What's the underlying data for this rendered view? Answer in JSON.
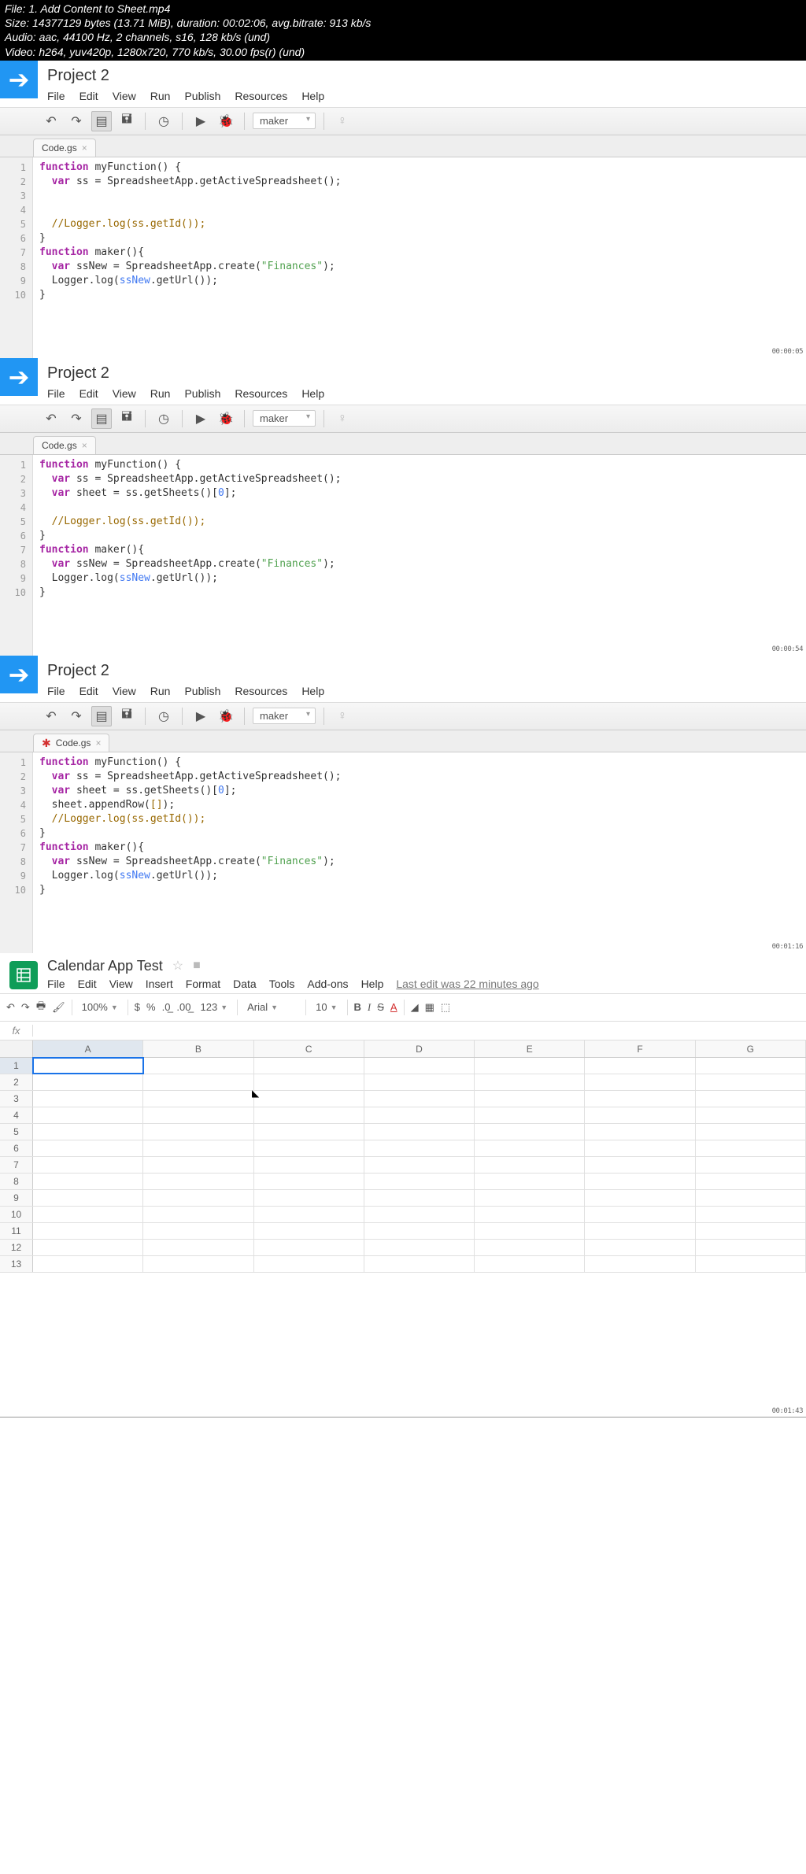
{
  "info": {
    "l1": "File: 1. Add Content to Sheet.mp4",
    "l2": "Size: 14377129 bytes (13.71 MiB), duration: 00:02:06, avg.bitrate: 913 kb/s",
    "l3": "Audio: aac, 44100 Hz, 2 channels, s16, 128 kb/s (und)",
    "l4": "Video: h264, yuv420p, 1280x720, 770 kb/s, 30.00 fps(r) (und)"
  },
  "menus": {
    "file": "File",
    "edit": "Edit",
    "view": "View",
    "run": "Run",
    "publish": "Publish",
    "resources": "Resources",
    "help": "Help"
  },
  "toolbar": {
    "func": "maker"
  },
  "pane1": {
    "title": "Project 2",
    "tab": "Code.gs",
    "dirty": false,
    "lines": [
      "1",
      "2",
      "3",
      "4",
      "5",
      "6",
      "7",
      "8",
      "9",
      "10"
    ],
    "code": [
      {
        "t": "function",
        "c": "kw"
      },
      {
        "t": " myFunction() {\n  ",
        "c": ""
      },
      {
        "t": "var",
        "c": "kw"
      },
      {
        "t": " ss = SpreadsheetApp.getActiveSpreadsheet();\n  \n  \n  ",
        "c": ""
      },
      {
        "t": "//Logger.log(ss.getId());",
        "c": "com"
      },
      {
        "t": "\n}\n",
        "c": ""
      },
      {
        "t": "function",
        "c": "kw"
      },
      {
        "t": " maker(){\n  ",
        "c": ""
      },
      {
        "t": "var",
        "c": "kw"
      },
      {
        "t": " ssNew = SpreadsheetApp.create(",
        "c": ""
      },
      {
        "t": "\"Finances\"",
        "c": "str"
      },
      {
        "t": ");\n  Logger.log(",
        "c": ""
      },
      {
        "t": "ssNew",
        "c": "var2"
      },
      {
        "t": ".getUrl());\n}\n",
        "c": ""
      }
    ],
    "ts": "00:00:05"
  },
  "pane2": {
    "title": "Project 2",
    "tab": "Code.gs",
    "dirty": false,
    "lines": [
      "1",
      "2",
      "3",
      "4",
      "5",
      "6",
      "7",
      "8",
      "9",
      "10"
    ],
    "code": [
      {
        "t": "function",
        "c": "kw"
      },
      {
        "t": " myFunction() {\n  ",
        "c": ""
      },
      {
        "t": "var",
        "c": "kw"
      },
      {
        "t": " ss = SpreadsheetApp.getActiveSpreadsheet();\n  ",
        "c": ""
      },
      {
        "t": "var",
        "c": "kw"
      },
      {
        "t": " sheet = ss.getSheets()[",
        "c": ""
      },
      {
        "t": "0",
        "c": "num"
      },
      {
        "t": "];\n  \n  ",
        "c": ""
      },
      {
        "t": "//Logger.log(ss.getId());",
        "c": "com"
      },
      {
        "t": "\n}\n",
        "c": ""
      },
      {
        "t": "function",
        "c": "kw"
      },
      {
        "t": " maker(){\n  ",
        "c": ""
      },
      {
        "t": "var",
        "c": "kw"
      },
      {
        "t": " ssNew = SpreadsheetApp.create(",
        "c": ""
      },
      {
        "t": "\"Finances\"",
        "c": "str"
      },
      {
        "t": ");\n  Logger.log(",
        "c": ""
      },
      {
        "t": "ssNew",
        "c": "var2"
      },
      {
        "t": ".getUrl());\n}\n",
        "c": ""
      }
    ],
    "ts": "00:00:54"
  },
  "pane3": {
    "title": "Project 2",
    "tab": "Code.gs",
    "dirty": true,
    "lines": [
      "1",
      "2",
      "3",
      "4",
      "5",
      "6",
      "7",
      "8",
      "9",
      "10"
    ],
    "code": [
      {
        "t": "function",
        "c": "kw"
      },
      {
        "t": " myFunction() {\n  ",
        "c": ""
      },
      {
        "t": "var",
        "c": "kw"
      },
      {
        "t": " ss = SpreadsheetApp.getActiveSpreadsheet();\n  ",
        "c": ""
      },
      {
        "t": "var",
        "c": "kw"
      },
      {
        "t": " sheet = ss.getSheets()[",
        "c": ""
      },
      {
        "t": "0",
        "c": "num"
      },
      {
        "t": "];\n  sheet.appendRow(",
        "c": ""
      },
      {
        "t": "[]",
        "c": "br"
      },
      {
        "t": ");\n  ",
        "c": ""
      },
      {
        "t": "//Logger.log(ss.getId());",
        "c": "com"
      },
      {
        "t": "\n}\n",
        "c": ""
      },
      {
        "t": "function",
        "c": "kw"
      },
      {
        "t": " maker(){\n  ",
        "c": ""
      },
      {
        "t": "var",
        "c": "kw"
      },
      {
        "t": " ssNew = SpreadsheetApp.create(",
        "c": ""
      },
      {
        "t": "\"Finances\"",
        "c": "str"
      },
      {
        "t": ");\n  Logger.log(",
        "c": ""
      },
      {
        "t": "ssNew",
        "c": "var2"
      },
      {
        "t": ".getUrl());\n}\n",
        "c": ""
      }
    ],
    "ts": "00:01:16"
  },
  "sheets": {
    "title": "Calendar App Test",
    "menus": {
      "file": "File",
      "edit": "Edit",
      "view": "View",
      "insert": "Insert",
      "format": "Format",
      "data": "Data",
      "tools": "Tools",
      "addons": "Add-ons",
      "help": "Help"
    },
    "lastedit": "Last edit was 22 minutes ago",
    "zoom": "100%",
    "font": "Arial",
    "fontsize": "10",
    "cols": [
      "A",
      "B",
      "C",
      "D",
      "E",
      "F",
      "G"
    ],
    "rows": [
      "1",
      "2",
      "3",
      "4",
      "5",
      "6",
      "7",
      "8",
      "9",
      "10",
      "11",
      "12",
      "13"
    ],
    "activeCell": "A1",
    "ts": "00:01:43"
  }
}
